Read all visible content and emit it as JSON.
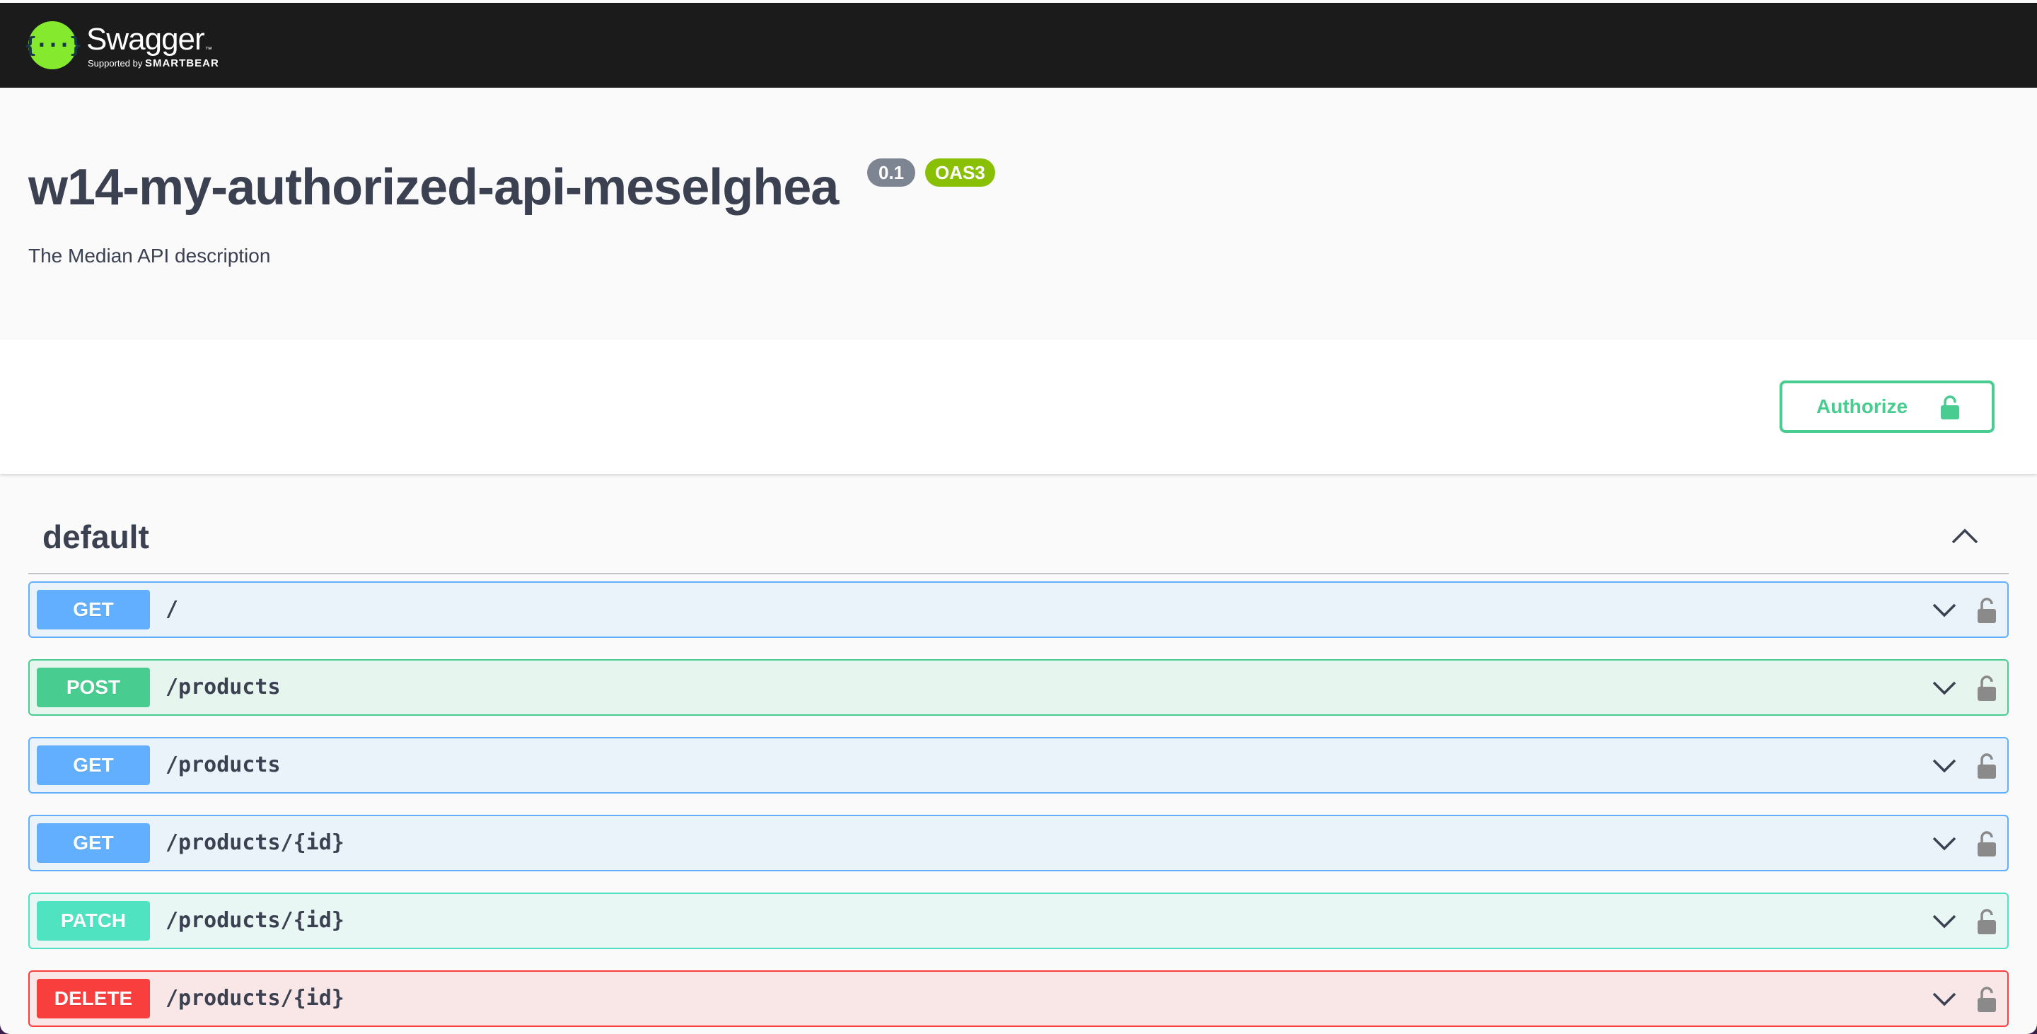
{
  "brand": {
    "name": "Swagger",
    "tm": "™",
    "supported_by": "Supported by",
    "company": "SMARTBEAR",
    "logo_glyph": "{···}"
  },
  "info": {
    "title": "w14-my-authorized-api-meselghea",
    "version": "0.1",
    "spec": "OAS3",
    "description": "The Median API description"
  },
  "auth": {
    "label": "Authorize",
    "icon": "unlocked-lock-icon"
  },
  "tag": {
    "name": "default",
    "icon": "chevron-up-icon"
  },
  "operations": [
    {
      "method": "GET",
      "path": "/"
    },
    {
      "method": "POST",
      "path": "/products"
    },
    {
      "method": "GET",
      "path": "/products"
    },
    {
      "method": "GET",
      "path": "/products/{id}"
    },
    {
      "method": "PATCH",
      "path": "/products/{id}"
    },
    {
      "method": "DELETE",
      "path": "/products/{id}"
    }
  ],
  "colors": {
    "get": "#61affe",
    "post": "#49cc90",
    "patch": "#50e3c2",
    "delete": "#f93e3e",
    "topbar": "#1b1b1b",
    "logo": "#85ea2d"
  }
}
